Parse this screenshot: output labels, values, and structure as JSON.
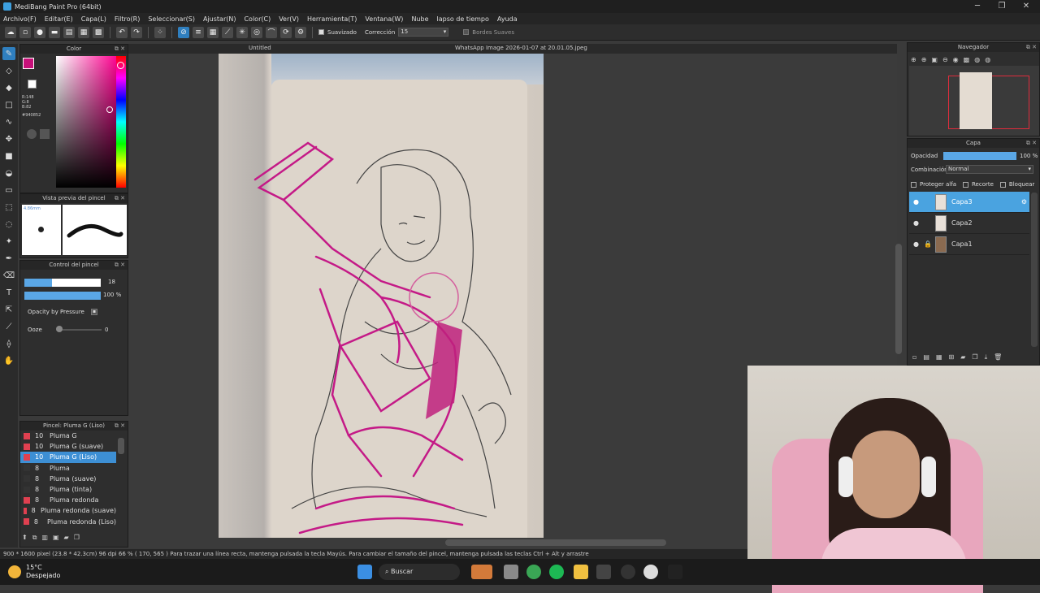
{
  "app": {
    "title": "MediBang Paint Pro (64bit)"
  },
  "menu": [
    "Archivo(F)",
    "Editar(E)",
    "Capa(L)",
    "Filtro(R)",
    "Seleccionar(S)",
    "Ajustar(N)",
    "Color(C)",
    "Ver(V)",
    "Herramienta(T)",
    "Ventana(W)",
    "Nube",
    "lapso de tiempo",
    "Ayuda"
  ],
  "toolbar": {
    "smooth_label": "Suavizado",
    "correction_label": "Corrección",
    "correction_value": "15",
    "soft_edges_label": "Bordes Suaves"
  },
  "color_panel": {
    "title": "Color",
    "r": "R:148",
    "g": "G:8",
    "b": "B:82",
    "hex": "#940852",
    "main_color": "#c8107a"
  },
  "brush_preview": {
    "title": "Vista previa del pincel",
    "size": "4.86mm"
  },
  "brush_control": {
    "title": "Control del pincel",
    "size_value": "18",
    "opacity_value": "100 %",
    "pressure_label": "Opacity by Pressure",
    "ooze_label": "Ooze",
    "ooze_value": "0"
  },
  "brush_list": {
    "title": "Pincel: Pluma G (Liso)",
    "items": [
      {
        "size": "10",
        "name": "Pluma G",
        "color": "#e04050"
      },
      {
        "size": "10",
        "name": "Pluma G (suave)",
        "color": "#e04050"
      },
      {
        "size": "10",
        "name": "Pluma G (Liso)",
        "color": "#e04050"
      },
      {
        "size": "8",
        "name": "Pluma",
        "color": "#333333"
      },
      {
        "size": "8",
        "name": "Pluma (suave)",
        "color": "#333333"
      },
      {
        "size": "8",
        "name": "Pluma (tinta)",
        "color": "#333333"
      },
      {
        "size": "8",
        "name": "Pluma redonda",
        "color": "#e04050"
      },
      {
        "size": "8",
        "name": "Pluma redonda (suave)",
        "color": "#e04050"
      },
      {
        "size": "8",
        "name": "Pluma redonda (Liso)",
        "color": "#e04050"
      }
    ]
  },
  "document": {
    "tab_label": "Untitled",
    "reference_title": "WhatsApp Image 2026-01-07 at 20.01.05.jpeg"
  },
  "navigator": {
    "title": "Navegador"
  },
  "layers": {
    "title": "Capa",
    "opacity_label": "Opacidad",
    "opacity_value": "100 %",
    "blend_label": "Combinación",
    "blend_value": "Normal",
    "protect_alpha": "Proteger alfa",
    "clipping": "Recorte",
    "lock": "Bloquear",
    "items": [
      {
        "name": "Capa3"
      },
      {
        "name": "Capa2"
      },
      {
        "name": "Capa1"
      }
    ]
  },
  "status": {
    "size": "900 * 1600 pixel",
    "cm": "(23.8 * 42.3cm)",
    "dpi": "96 dpi",
    "zoom": "66 %",
    "coords": "( 170, 565 )",
    "hint": "Para trazar una línea recta, mantenga pulsada la tecla Mayús. Para cambiar el tamaño del pincel, mantenga pulsada las teclas Ctrl + Alt y arrastre"
  },
  "taskbar": {
    "weather_temp": "15°C",
    "weather_desc": "Despejado",
    "search_label": "Buscar"
  }
}
